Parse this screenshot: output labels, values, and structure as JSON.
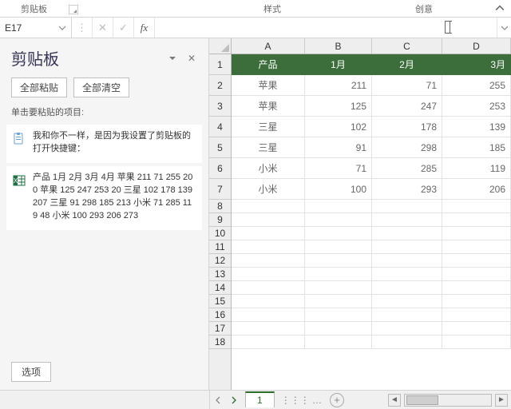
{
  "ribbon": {
    "group_clipboard": "剪贴板",
    "group_styles": "样式",
    "group_creative": "创意"
  },
  "formula_bar": {
    "name_box": "E17",
    "fx_label": "fx"
  },
  "clipboard_pane": {
    "title": "剪贴板",
    "paste_all": "全部粘贴",
    "clear_all": "全部清空",
    "hint": "单击要粘贴的项目:",
    "options_label": "选项",
    "items": [
      {
        "icon": "paste",
        "text": "我和你不一样，是因为我设置了剪贴板的打开快捷键："
      },
      {
        "icon": "excel",
        "text": "产品 1月 2月 3月 4月 苹果 211 71 255 200 苹果 125 247 253 20 三星 102 178 139 207 三星 91 298 185 213 小米 71 285 119 48 小米 100 293 206 273"
      }
    ]
  },
  "sheet": {
    "columns": [
      "A",
      "B",
      "C",
      "D"
    ],
    "row_count": 18,
    "tall_rows": 7,
    "header_row": [
      "产品",
      "1月",
      "2月",
      "3月"
    ],
    "data_rows": [
      [
        "苹果",
        "211",
        "71",
        "255"
      ],
      [
        "苹果",
        "125",
        "247",
        "253"
      ],
      [
        "三星",
        "102",
        "178",
        "139"
      ],
      [
        "三星",
        "91",
        "298",
        "185"
      ],
      [
        "小米",
        "71",
        "285",
        "119"
      ],
      [
        "小米",
        "100",
        "293",
        "206"
      ]
    ]
  },
  "statusbar": {
    "sheet_tab": "1"
  },
  "chart_data": {
    "type": "table",
    "title": "",
    "columns": [
      "产品",
      "1月",
      "2月",
      "3月"
    ],
    "rows": [
      [
        "苹果",
        211,
        71,
        255
      ],
      [
        "苹果",
        125,
        247,
        253
      ],
      [
        "三星",
        102,
        178,
        139
      ],
      [
        "三星",
        91,
        298,
        185
      ],
      [
        "小米",
        71,
        285,
        119
      ],
      [
        "小米",
        100,
        293,
        206
      ]
    ]
  }
}
